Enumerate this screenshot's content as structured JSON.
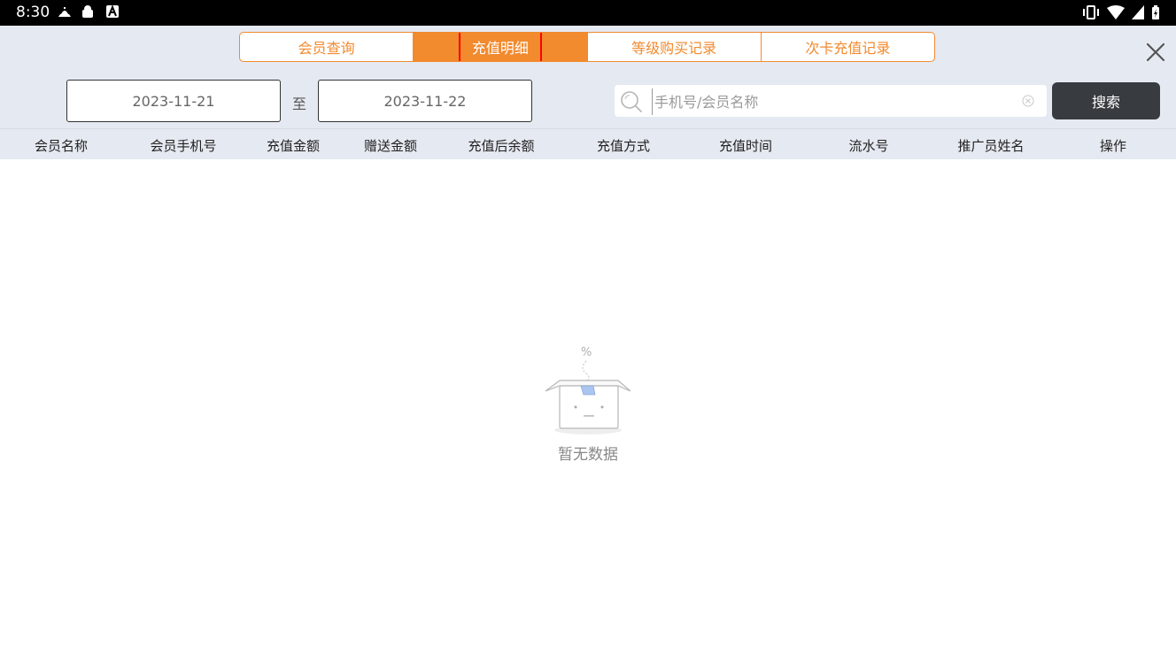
{
  "status_bar": {
    "time": "8:30"
  },
  "tabs": [
    {
      "label": "会员查询",
      "active": false
    },
    {
      "label": "充值明细",
      "active": true
    },
    {
      "label": "等级购买记录",
      "active": false
    },
    {
      "label": "次卡充值记录",
      "active": false
    }
  ],
  "filters": {
    "start_date": "2023-11-21",
    "separator": "至",
    "end_date": "2023-11-22",
    "search_placeholder": "手机号/会员名称",
    "search_button": "搜索"
  },
  "table": {
    "columns": [
      "会员名称",
      "会员手机号",
      "充值金额",
      "赠送金额",
      "充值后余额",
      "充值方式",
      "充值时间",
      "流水号",
      "推广员姓名",
      "操作"
    ],
    "rows": []
  },
  "empty_state": {
    "text": "暂无数据"
  },
  "colors": {
    "accent": "#f28a2e",
    "header_bg": "#e5e9f1",
    "search_button_bg": "#383b40",
    "highlight": "#ff0000"
  }
}
